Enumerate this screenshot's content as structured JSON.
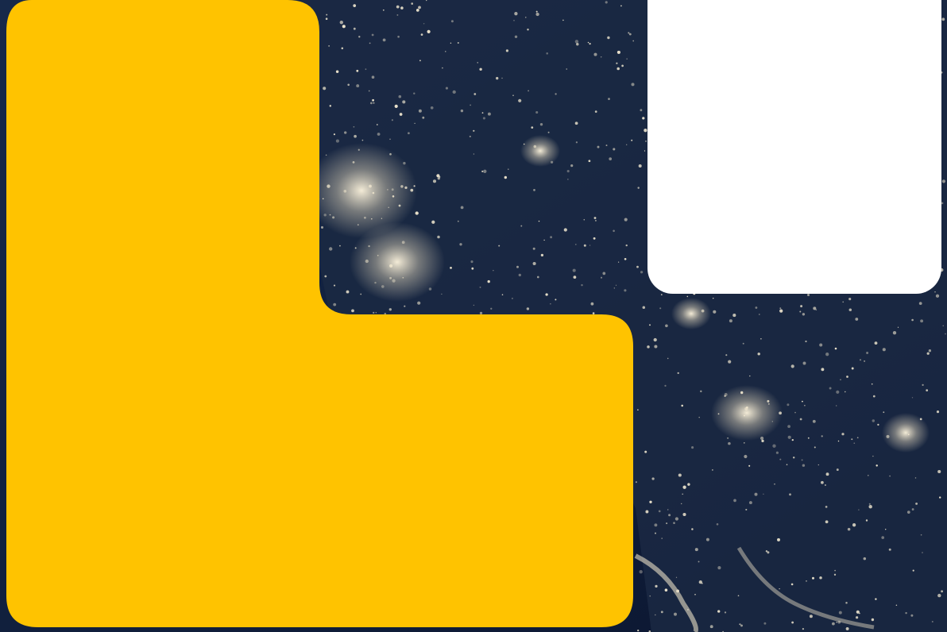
{
  "background": {
    "kind": "night-earth-city-lights-photo",
    "colors": {
      "ocean": "#0e1a33",
      "land": "#1d2a44",
      "lights": "#f6efd9"
    }
  },
  "shapes": {
    "l_shape_color": "#ffc300",
    "square_color": "#ffffff"
  }
}
